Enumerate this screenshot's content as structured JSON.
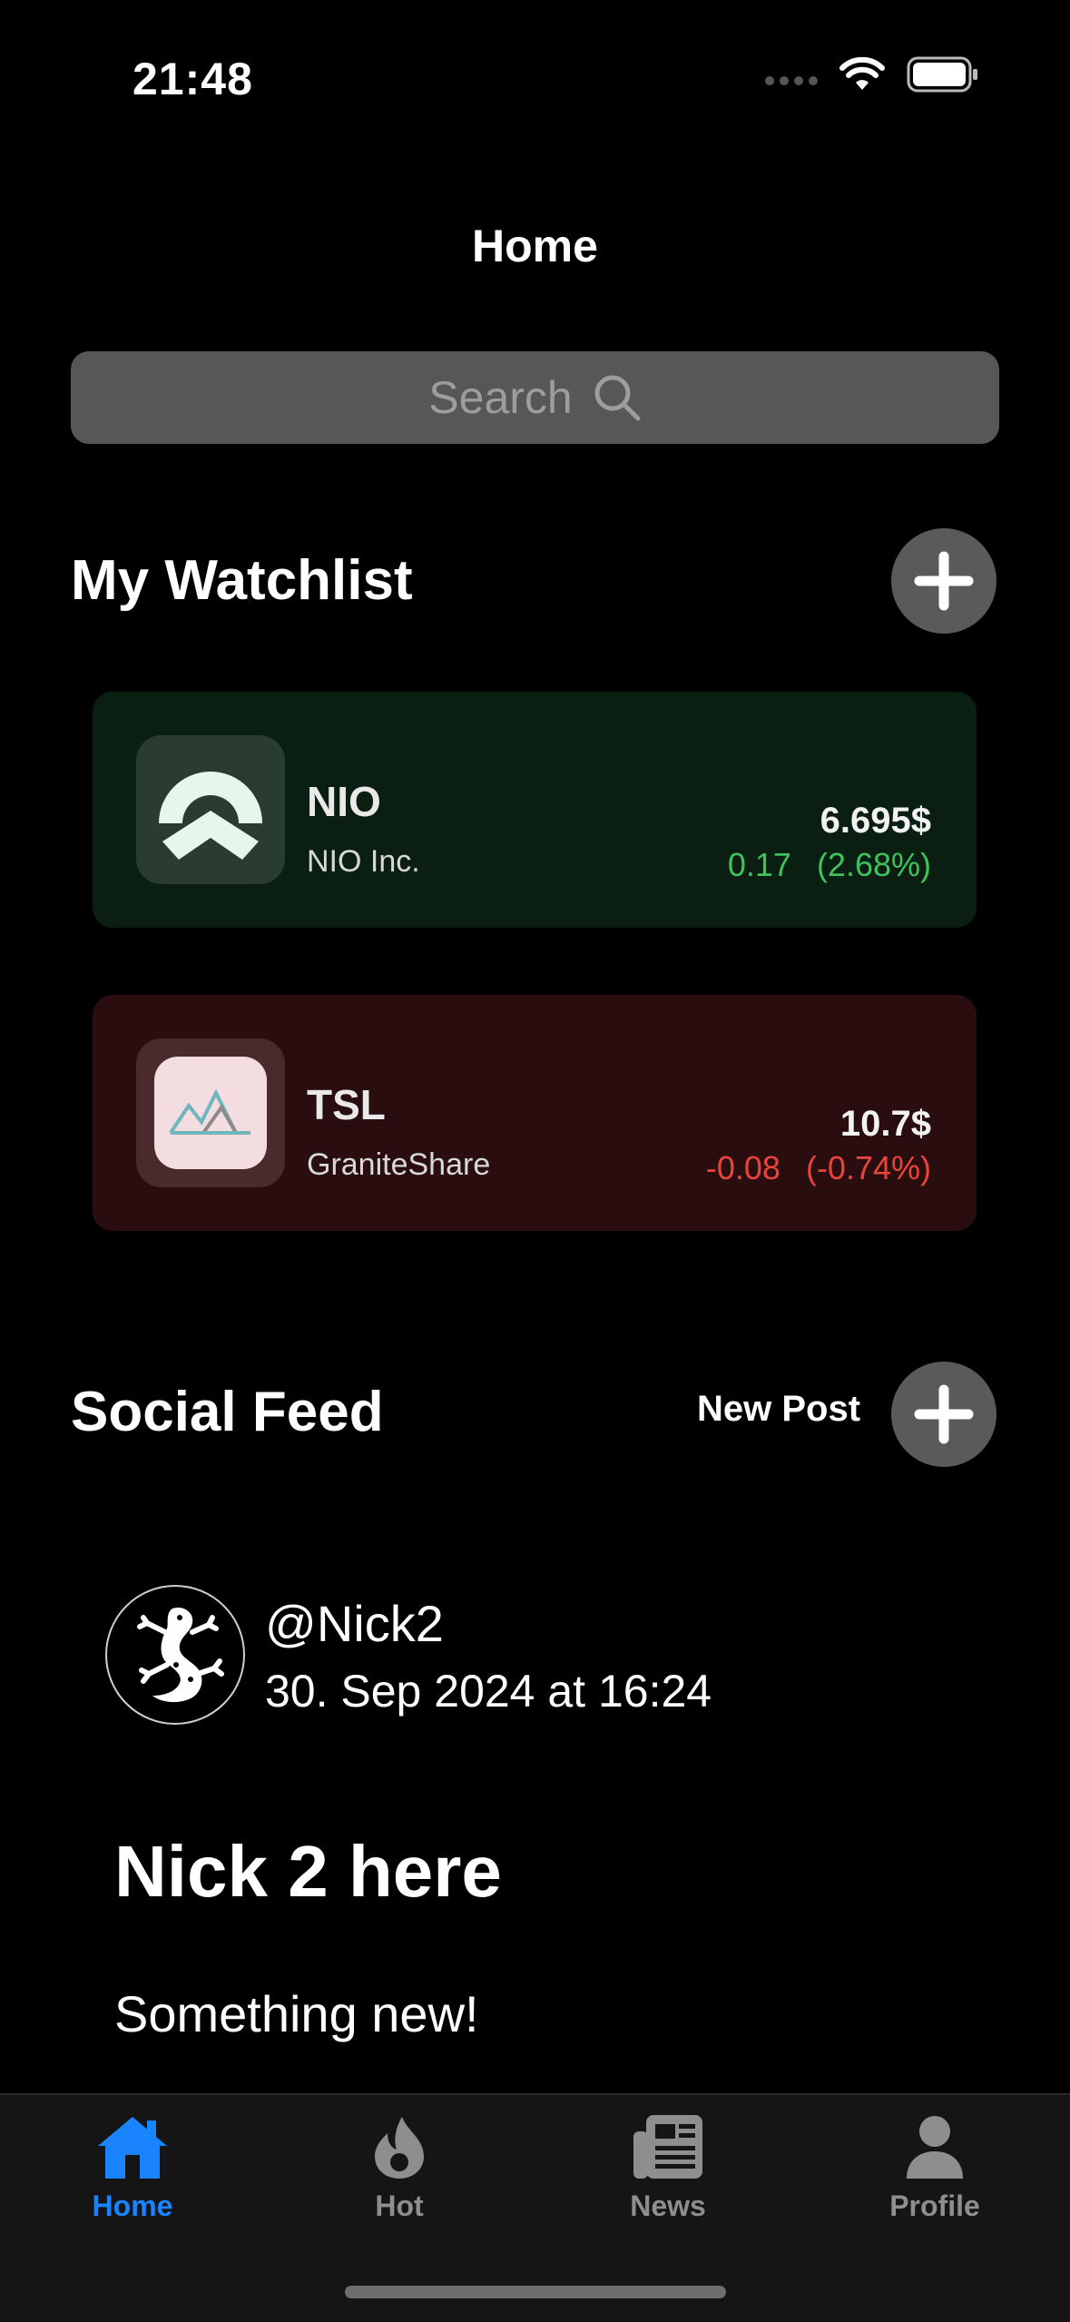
{
  "status_bar": {
    "time": "21:48"
  },
  "nav": {
    "title": "Home"
  },
  "search": {
    "placeholder": "Search"
  },
  "watchlist": {
    "title": "My Watchlist",
    "items": [
      {
        "ticker": "NIO",
        "company": "NIO Inc.",
        "price": "6.695$",
        "change": "0.17",
        "change_pct": "(2.68%)",
        "trend": "up"
      },
      {
        "ticker": "TSL",
        "company": "GraniteShare",
        "price": "10.7$",
        "change": "-0.08",
        "change_pct": "(-0.74%)",
        "trend": "down"
      }
    ]
  },
  "social_feed": {
    "title": "Social Feed",
    "new_post_label": "New Post",
    "posts": [
      {
        "username": "@Nick2",
        "date": "30. Sep 2024 at 16:24",
        "title": "Nick 2 here",
        "body": "Something new!"
      }
    ]
  },
  "tabbar": {
    "tabs": [
      {
        "label": "Home",
        "icon": "house-icon",
        "active": true
      },
      {
        "label": "Hot",
        "icon": "flame-icon",
        "active": false
      },
      {
        "label": "News",
        "icon": "newspaper-icon",
        "active": false
      },
      {
        "label": "Profile",
        "icon": "person-icon",
        "active": false
      }
    ]
  },
  "colors": {
    "active_tab": "#1a84ff",
    "inactive_tab": "#8e8e8e",
    "gain": "#3fc15b",
    "loss": "#e8443c"
  }
}
